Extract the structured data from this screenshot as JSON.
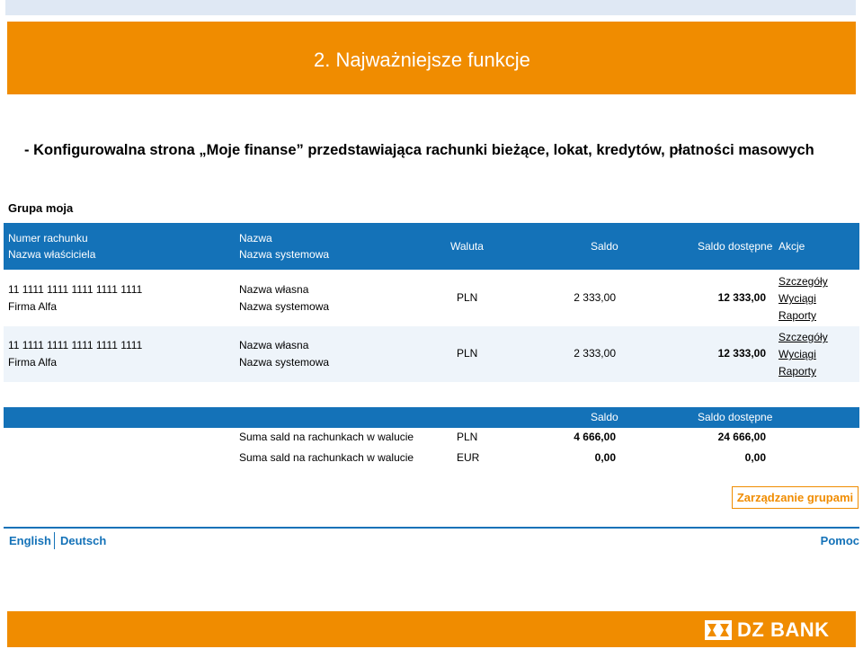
{
  "slide": {
    "title": "2. Najważniejsze funkcje",
    "subtitle": "- Konfigurowalna strona „Moje finanse” przedstawiająca rachunki bieżące, lokat, kredytów, płatności masowych"
  },
  "group": {
    "title": "Grupa moja"
  },
  "table": {
    "headers": {
      "account_number": "Numer rachunku",
      "owner_name": "Nazwa właściciela",
      "name": "Nazwa",
      "system_name": "Nazwa systemowa",
      "currency": "Waluta",
      "balance": "Saldo",
      "available_balance": "Saldo dostępne",
      "actions": "Akcje"
    },
    "rows": [
      {
        "account_number": "11 1111 1111 1111 1111 1111",
        "owner_name": "Firma Alfa",
        "own_name": "Nazwa własna",
        "system_name": "Nazwa systemowa",
        "currency": "PLN",
        "balance": "2 333,00",
        "available_balance": "12 333,00",
        "actions": [
          "Szczegóły",
          "Wyciągi",
          "Raporty"
        ]
      },
      {
        "account_number": "11 1111 1111 1111 1111 1111",
        "owner_name": "Firma Alfa",
        "own_name": "Nazwa własna",
        "system_name": "Nazwa systemowa",
        "currency": "PLN",
        "balance": "2 333,00",
        "available_balance": "12 333,00",
        "actions": [
          "Szczegóły",
          "Wyciągi",
          "Raporty"
        ]
      }
    ]
  },
  "summary": {
    "headers": {
      "balance": "Saldo",
      "available_balance": "Saldo dostępne"
    },
    "rows": [
      {
        "label": "Suma sald na rachunkach w walucie",
        "currency": "PLN",
        "balance": "4 666,00",
        "available_balance": "24 666,00"
      },
      {
        "label": "Suma sald na rachunkach w walucie",
        "currency": "EUR",
        "balance": "0,00",
        "available_balance": "0,00"
      }
    ]
  },
  "manage_button": "Zarządzanie grupami",
  "footer": {
    "languages": [
      "English",
      "Deutsch"
    ],
    "help": "Pomoc"
  },
  "brand": {
    "name": "DZ BANK",
    "logo_icon": "dz-bank-logo-icon"
  },
  "colors": {
    "accent_orange": "#f08c00",
    "table_blue": "#1472b8"
  }
}
